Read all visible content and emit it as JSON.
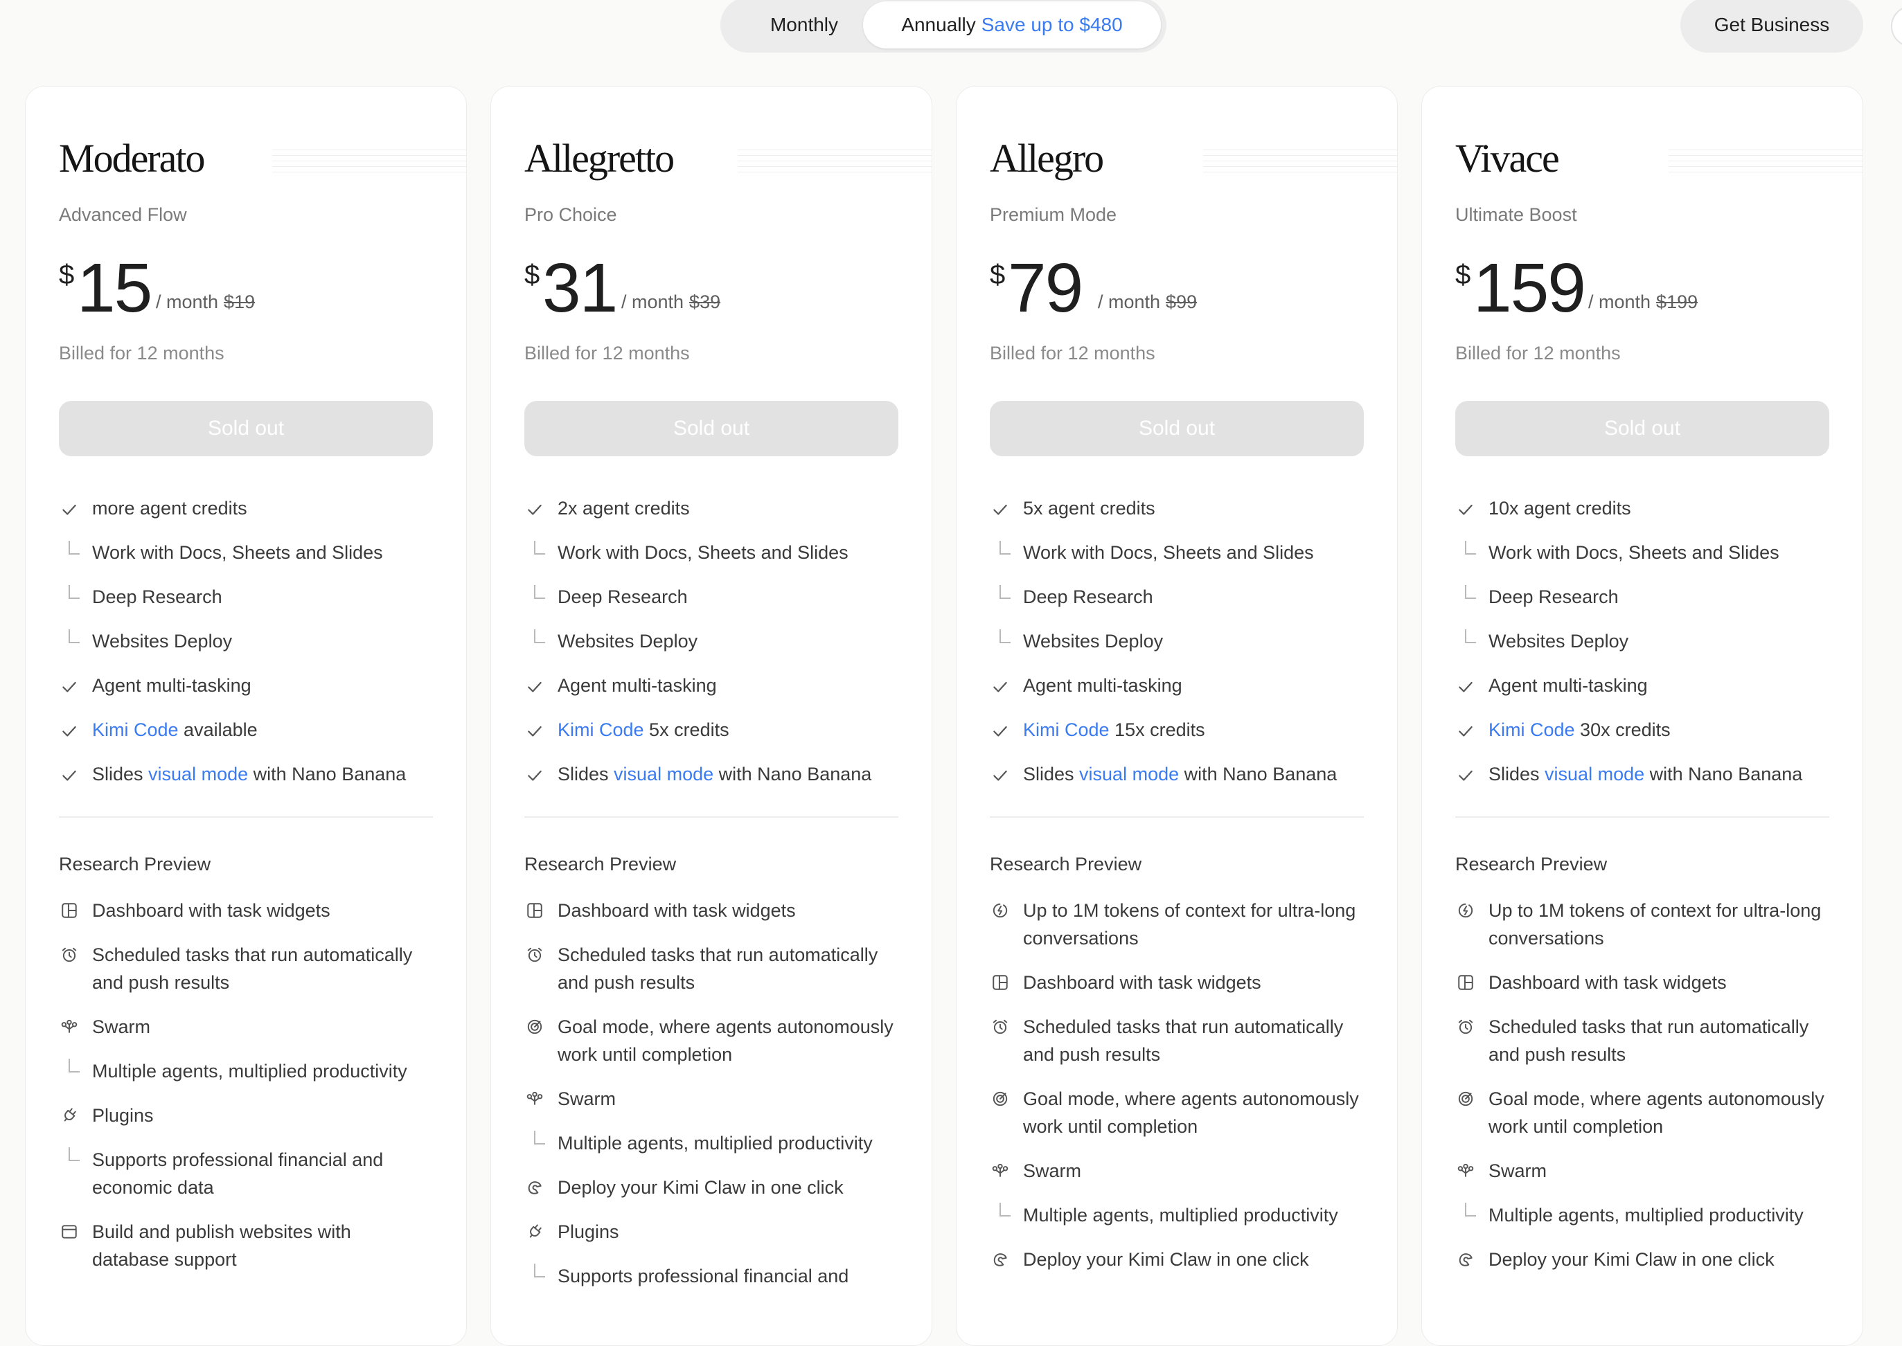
{
  "toggle": {
    "monthly": "Monthly",
    "annually": "Annually",
    "save": "Save up to $480"
  },
  "get_business": "Get Business",
  "colors": {
    "accent": "#3a7bf2",
    "sold_out_bg": "#e2e2e2"
  },
  "research_title": "Research Preview",
  "plans": [
    {
      "name": "Moderato",
      "subtitle": "Advanced Flow",
      "currency": "$",
      "price": "15",
      "per": "/ month",
      "original": "$19",
      "billed": "Billed for 12 months",
      "button": "Sold out",
      "features": [
        {
          "type": "check",
          "text": "more agent credits"
        },
        {
          "type": "sub",
          "text": "Work with Docs, Sheets and Slides"
        },
        {
          "type": "sub",
          "text": "Deep Research"
        },
        {
          "type": "sub",
          "text": "Websites Deploy"
        },
        {
          "type": "check",
          "text": "Agent multi-tasking"
        },
        {
          "type": "check",
          "link": "Kimi Code",
          "text": " available"
        },
        {
          "type": "check",
          "prefix": "Slides ",
          "link": "visual mode",
          "text": " with Nano Banana"
        }
      ],
      "research": [
        {
          "icon": "dashboard-icon",
          "text": "Dashboard with task widgets"
        },
        {
          "icon": "alarm-clock-icon",
          "text": "Scheduled tasks that run automatically and push results"
        },
        {
          "icon": "swarm-icon",
          "text": "Swarm"
        },
        {
          "icon": "sub",
          "text": "Multiple agents, multiplied productivity"
        },
        {
          "icon": "plug-icon",
          "text": "Plugins"
        },
        {
          "icon": "sub",
          "text": "Supports professional financial and economic data"
        },
        {
          "icon": "browser-window-icon",
          "text": "Build and publish websites with database support"
        }
      ]
    },
    {
      "name": "Allegretto",
      "subtitle": "Pro Choice",
      "currency": "$",
      "price": "31",
      "per": "/ month",
      "original": "$39",
      "billed": "Billed for 12 months",
      "button": "Sold out",
      "features": [
        {
          "type": "check",
          "text": "2x agent credits"
        },
        {
          "type": "sub",
          "text": "Work with Docs, Sheets and Slides"
        },
        {
          "type": "sub",
          "text": "Deep Research"
        },
        {
          "type": "sub",
          "text": "Websites Deploy"
        },
        {
          "type": "check",
          "text": "Agent multi-tasking"
        },
        {
          "type": "check",
          "link": "Kimi Code",
          "text": " 5x credits"
        },
        {
          "type": "check",
          "prefix": "Slides ",
          "link": "visual mode",
          "text": " with Nano Banana"
        }
      ],
      "research": [
        {
          "icon": "dashboard-icon",
          "text": "Dashboard with task widgets"
        },
        {
          "icon": "alarm-clock-icon",
          "text": "Scheduled tasks that run automatically and push results"
        },
        {
          "icon": "goal-icon",
          "text": "Goal mode, where agents autonomously work until completion"
        },
        {
          "icon": "swarm-icon",
          "text": "Swarm"
        },
        {
          "icon": "sub",
          "text": "Multiple agents, multiplied productivity"
        },
        {
          "icon": "claw-icon",
          "text": "Deploy your Kimi Claw in one click"
        },
        {
          "icon": "plug-icon",
          "text": "Plugins"
        },
        {
          "icon": "sub",
          "text": "Supports professional financial and"
        }
      ]
    },
    {
      "name": "Allegro",
      "subtitle": "Premium Mode",
      "currency": "$",
      "price": "79",
      "per": "/ month",
      "original": "$99",
      "billed": "Billed for 12 months",
      "button": "Sold out",
      "features": [
        {
          "type": "check",
          "text": "5x agent credits"
        },
        {
          "type": "sub",
          "text": "Work with Docs, Sheets and Slides"
        },
        {
          "type": "sub",
          "text": "Deep Research"
        },
        {
          "type": "sub",
          "text": "Websites Deploy"
        },
        {
          "type": "check",
          "text": "Agent multi-tasking"
        },
        {
          "type": "check",
          "link": "Kimi Code",
          "text": " 15x credits"
        },
        {
          "type": "check",
          "prefix": "Slides ",
          "link": "visual mode",
          "text": " with Nano Banana"
        }
      ],
      "research": [
        {
          "icon": "context-icon",
          "text": "Up to 1M tokens of context for ultra-long conversations"
        },
        {
          "icon": "dashboard-icon",
          "text": "Dashboard with task widgets"
        },
        {
          "icon": "alarm-clock-icon",
          "text": "Scheduled tasks that run automatically and push results"
        },
        {
          "icon": "goal-icon",
          "text": "Goal mode, where agents autonomously work until completion"
        },
        {
          "icon": "swarm-icon",
          "text": "Swarm"
        },
        {
          "icon": "sub",
          "text": "Multiple agents, multiplied productivity"
        },
        {
          "icon": "claw-icon",
          "text": "Deploy your Kimi Claw in one click"
        }
      ]
    },
    {
      "name": "Vivace",
      "subtitle": "Ultimate Boost",
      "currency": "$",
      "price": "159",
      "per": "/ month",
      "original": "$199",
      "billed": "Billed for 12 months",
      "button": "Sold out",
      "features": [
        {
          "type": "check",
          "text": "10x agent credits"
        },
        {
          "type": "sub",
          "text": "Work with Docs, Sheets and Slides"
        },
        {
          "type": "sub",
          "text": "Deep Research"
        },
        {
          "type": "sub",
          "text": "Websites Deploy"
        },
        {
          "type": "check",
          "text": "Agent multi-tasking"
        },
        {
          "type": "check",
          "link": "Kimi Code",
          "text": " 30x credits"
        },
        {
          "type": "check",
          "prefix": "Slides ",
          "link": "visual mode",
          "text": " with Nano Banana"
        }
      ],
      "research": [
        {
          "icon": "context-icon",
          "text": "Up to 1M tokens of context for ultra-long conversations"
        },
        {
          "icon": "dashboard-icon",
          "text": "Dashboard with task widgets"
        },
        {
          "icon": "alarm-clock-icon",
          "text": "Scheduled tasks that run automatically and push results"
        },
        {
          "icon": "goal-icon",
          "text": "Goal mode, where agents autonomously work until completion"
        },
        {
          "icon": "swarm-icon",
          "text": "Swarm"
        },
        {
          "icon": "sub",
          "text": "Multiple agents, multiplied productivity"
        },
        {
          "icon": "claw-icon",
          "text": "Deploy your Kimi Claw in one click"
        }
      ]
    }
  ]
}
